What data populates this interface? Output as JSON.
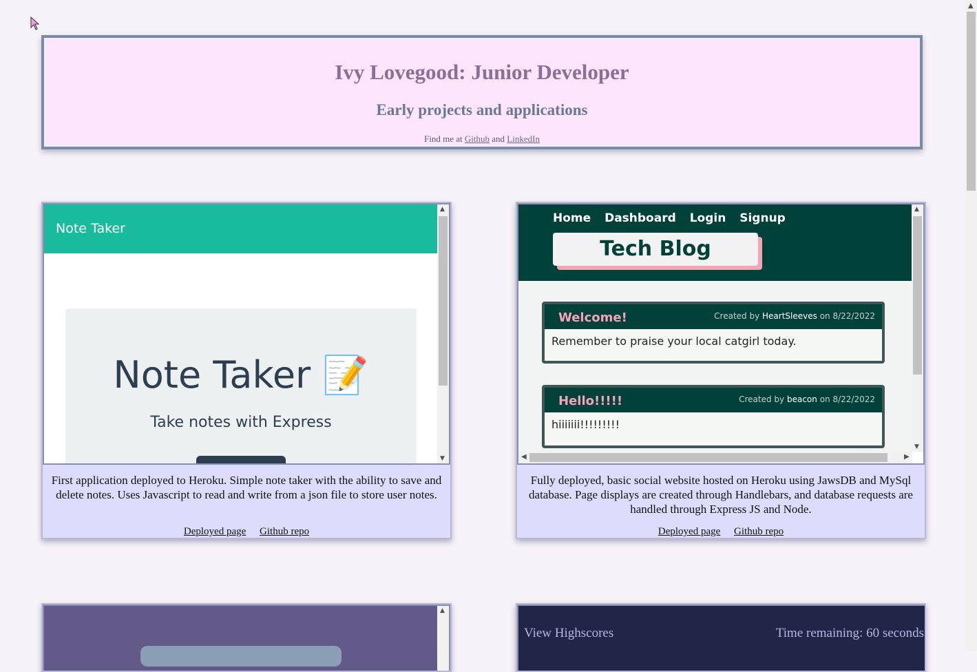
{
  "header": {
    "title": "Ivy Lovegood: Junior Developer",
    "subtitle": "Early projects and applications",
    "find_prefix": "Find me at",
    "github_label": "Github",
    "and_text": "and",
    "linkedin_label": "LinkedIn"
  },
  "projects": [
    {
      "preview": {
        "nav_brand": "Note Taker",
        "heading": "Note Taker 📝",
        "tagline": "Take notes with Express"
      },
      "description": "First application deployed to Heroku. Simple note taker with the ability to save and delete notes. Uses Javascript to read and write from a json file to store user notes.",
      "deployed_label": "Deployed page",
      "repo_label": "Github repo"
    },
    {
      "preview": {
        "nav": [
          "Home",
          "Dashboard",
          "Login",
          "Signup"
        ],
        "title": "Tech Blog",
        "posts": [
          {
            "title": "Welcome!",
            "created_by": "Created by",
            "author": "HeartSleeves",
            "on": "on 8/22/2022",
            "body": "Remember to praise your local catgirl today."
          },
          {
            "title": "Hello!!!!!",
            "created_by": "Created by",
            "author": "beacon",
            "on": "on 8/22/2022",
            "body": "hiiiiiii!!!!!!!!!"
          }
        ]
      },
      "description": "Fully deployed, basic social website hosted on Heroku using JawsDB and MySql database. Page displays are created through Handlebars, and database requests are handled through Express JS and Node.",
      "deployed_label": "Deployed page",
      "repo_label": "Github repo"
    },
    {
      "preview": {}
    },
    {
      "preview": {
        "left": "View Highscores",
        "right": "Time remaining: 60 seconds"
      }
    }
  ],
  "colors": {
    "header_bg": "#fde6fb",
    "card_bg": "#dcdcfc",
    "note_taker_accent": "#18bc9c",
    "tech_blog_dark": "#00413a",
    "tech_blog_pink": "#f4a4b4",
    "quiz_bg": "#222545"
  }
}
